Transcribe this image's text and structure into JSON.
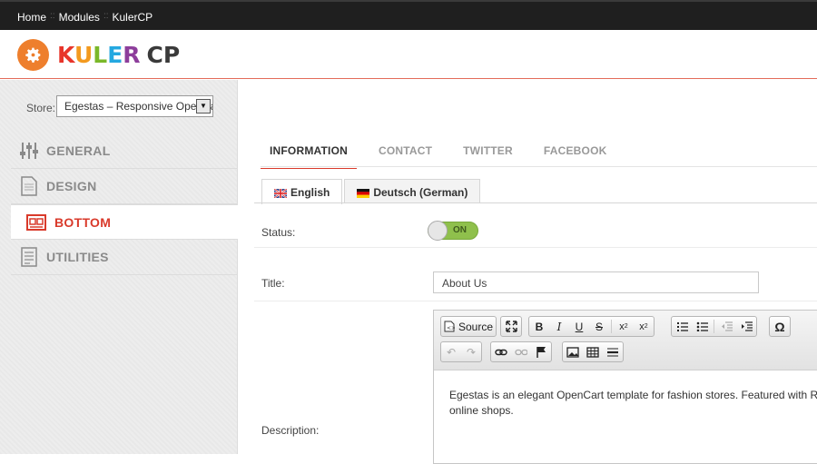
{
  "breadcrumb": [
    "Home",
    "Modules",
    "KulerCP"
  ],
  "logo": {
    "word1": "KULER",
    "word2": "CP",
    "letter_colors": [
      "#e8352b",
      "#f39a1f",
      "#7ab829",
      "#24a8e0",
      "#8d3e9b"
    ],
    "gear_color": "#ee7f2d"
  },
  "store": {
    "label": "Store:",
    "value": "Egestas – Responsive OpenCart"
  },
  "nav": [
    {
      "label": "GENERAL",
      "icon": "sliders-icon"
    },
    {
      "label": "DESIGN",
      "icon": "document-icon"
    },
    {
      "label": "BOTTOM",
      "icon": "layout-bottom-icon",
      "active": true
    },
    {
      "label": "UTILITIES",
      "icon": "checklist-icon"
    }
  ],
  "tabs": [
    "INFORMATION",
    "CONTACT",
    "TWITTER",
    "FACEBOOK"
  ],
  "active_tab": "INFORMATION",
  "languages": [
    "English",
    "Deutsch (German)"
  ],
  "active_language": "English",
  "form": {
    "status_label": "Status:",
    "status_value": "ON",
    "title_label": "Title:",
    "title_value": "About Us",
    "description_label": "Description:",
    "description_text_line1": "Egestas is an elegant OpenCart template for fashion stores. Featured with Responsive",
    "description_text_line2": "online shops."
  },
  "editor_toolbar": {
    "source_label": "Source",
    "row1": [
      "maximize-icon",
      "bold-icon",
      "italic-icon",
      "underline-icon",
      "strike-icon",
      "subscript-icon",
      "superscript-icon",
      "numbered-list-icon",
      "bullet-list-icon",
      "outdent-icon",
      "indent-icon",
      "special-char-icon"
    ],
    "row2": [
      "undo-icon",
      "redo-icon",
      "link-icon",
      "unlink-icon",
      "anchor-icon",
      "image-icon",
      "table-icon",
      "horizontal-rule-icon"
    ]
  },
  "colors": {
    "accent": "#d93a2b",
    "toggle_on": "#8fc04c",
    "topbar": "#1f1f1f"
  }
}
